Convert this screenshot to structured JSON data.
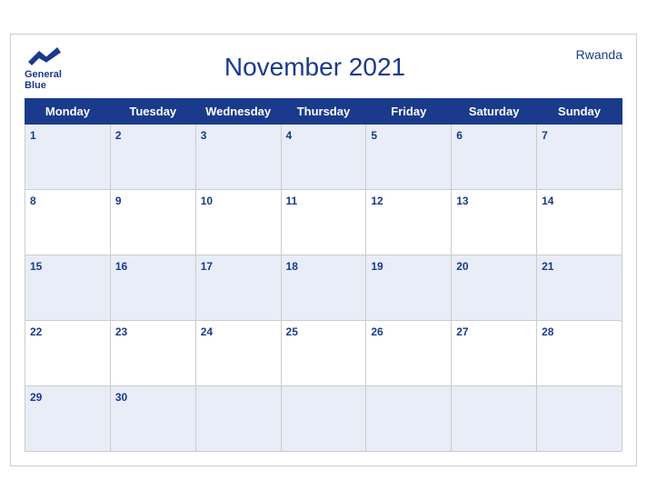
{
  "header": {
    "title": "November 2021",
    "country": "Rwanda",
    "logo_line1": "General",
    "logo_line2": "Blue"
  },
  "weekdays": [
    "Monday",
    "Tuesday",
    "Wednesday",
    "Thursday",
    "Friday",
    "Saturday",
    "Sunday"
  ],
  "weeks": [
    [
      1,
      2,
      3,
      4,
      5,
      6,
      7
    ],
    [
      8,
      9,
      10,
      11,
      12,
      13,
      14
    ],
    [
      15,
      16,
      17,
      18,
      19,
      20,
      21
    ],
    [
      22,
      23,
      24,
      25,
      26,
      27,
      28
    ],
    [
      29,
      30,
      null,
      null,
      null,
      null,
      null
    ]
  ]
}
